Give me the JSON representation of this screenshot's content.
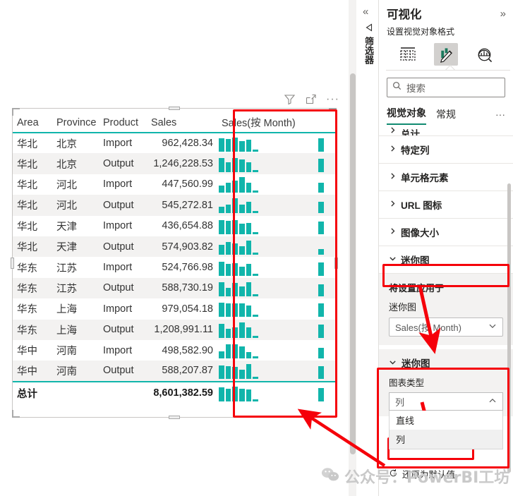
{
  "visual_toolbar": {
    "filter_icon": "filter-icon",
    "focus_icon": "focus-mode-icon",
    "more_label": "···"
  },
  "table": {
    "columns": [
      "Area",
      "Province",
      "Product",
      "Sales",
      "Sales(按 Month)"
    ],
    "rows": [
      {
        "area": "华北",
        "province": "北京",
        "product": "Import",
        "sales": "962,428.34",
        "spark": [
          19,
          18,
          20,
          15,
          17,
          3
        ],
        "tail": 19
      },
      {
        "area": "华北",
        "province": "北京",
        "product": "Output",
        "sales": "1,246,228.53",
        "spark": [
          20,
          14,
          20,
          18,
          14,
          3
        ],
        "tail": 19
      },
      {
        "area": "华北",
        "province": "河北",
        "product": "Import",
        "sales": "447,560.99",
        "spark": [
          10,
          14,
          17,
          22,
          14,
          3
        ],
        "tail": 14
      },
      {
        "area": "华北",
        "province": "河北",
        "product": "Output",
        "sales": "545,272.81",
        "spark": [
          9,
          12,
          21,
          12,
          16,
          3
        ],
        "tail": 16
      },
      {
        "area": "华北",
        "province": "天津",
        "product": "Import",
        "sales": "436,654.88",
        "spark": [
          20,
          19,
          20,
          15,
          16,
          3
        ],
        "tail": 18
      },
      {
        "area": "华北",
        "province": "天津",
        "product": "Output",
        "sales": "574,903.82",
        "spark": [
          14,
          18,
          16,
          12,
          20,
          3
        ],
        "tail": 8
      },
      {
        "area": "华东",
        "province": "江苏",
        "product": "Import",
        "sales": "524,766.98",
        "spark": [
          20,
          17,
          18,
          13,
          17,
          3
        ],
        "tail": 19
      },
      {
        "area": "华东",
        "province": "江苏",
        "product": "Output",
        "sales": "588,730.19",
        "spark": [
          20,
          12,
          19,
          14,
          20,
          3
        ],
        "tail": 17
      },
      {
        "area": "华东",
        "province": "上海",
        "product": "Import",
        "sales": "979,054.18",
        "spark": [
          20,
          19,
          19,
          19,
          16,
          3
        ],
        "tail": 19
      },
      {
        "area": "华东",
        "province": "上海",
        "product": "Output",
        "sales": "1,208,991.11",
        "spark": [
          20,
          13,
          15,
          22,
          15,
          3
        ],
        "tail": 19
      },
      {
        "area": "华中",
        "province": "河南",
        "product": "Import",
        "sales": "498,582.90",
        "spark": [
          10,
          20,
          20,
          17,
          9,
          3
        ],
        "tail": 15
      },
      {
        "area": "华中",
        "province": "河南",
        "product": "Output",
        "sales": "588,207.87",
        "spark": [
          19,
          18,
          17,
          13,
          21,
          3
        ],
        "tail": 18
      }
    ],
    "total": {
      "label": "总计",
      "sales": "8,601,382.59",
      "spark": [
        20,
        18,
        21,
        18,
        17,
        3
      ],
      "tail": 19
    }
  },
  "left_rail": {
    "collapse_icon": "double-chevron-left-icon",
    "filter_icon": "filter-funnel-icon",
    "label": "筛选器"
  },
  "viz_pane": {
    "title": "可视化",
    "expand_icon": "double-chevron-right-icon",
    "subtitle": "设置视觉对象格式",
    "icons": [
      {
        "name": "build-visual-icon",
        "selected": false
      },
      {
        "name": "format-visual-icon",
        "selected": true
      },
      {
        "name": "analytics-icon",
        "selected": false
      }
    ],
    "search": {
      "icon": "search-icon",
      "placeholder": "搜索",
      "value": "搜索"
    },
    "tabs": [
      {
        "label": "视觉对象",
        "selected": true
      },
      {
        "label": "常规",
        "selected": false
      }
    ],
    "tab_more": "···",
    "accordion": [
      {
        "label": "总计",
        "expanded": false,
        "clipped": true
      },
      {
        "label": "特定列",
        "expanded": false
      },
      {
        "label": "单元格元素",
        "expanded": false
      },
      {
        "label": "URL 图标",
        "expanded": false
      },
      {
        "label": "图像大小",
        "expanded": false
      },
      {
        "label": "迷你图",
        "expanded": true,
        "highlighted": true
      }
    ],
    "apply_card": {
      "title": "将设置应用于",
      "field_label": "迷你图",
      "selected": "Sales(按 Month)",
      "chevron": "chevron-down-icon"
    },
    "mini_card": {
      "title": "迷你图",
      "chevron": "chevron-down-icon",
      "chart_type_label": "图表类型",
      "chart_type_value": "列",
      "chart_type_chevron": "chevron-up-icon",
      "options": [
        {
          "label": "直线",
          "highlighted": false
        },
        {
          "label": "列",
          "highlighted": true
        }
      ]
    },
    "reset": {
      "icon": "reset-icon",
      "label": "还原为默认值"
    }
  },
  "watermark": {
    "icon": "wechat-icon",
    "text": "公众号：PowerBI工坊"
  },
  "colors": {
    "sparkline": "#11b5ab",
    "accent": "#118a71",
    "annotation_red": "#f5000a",
    "alt_row": "#f3f2f1"
  }
}
